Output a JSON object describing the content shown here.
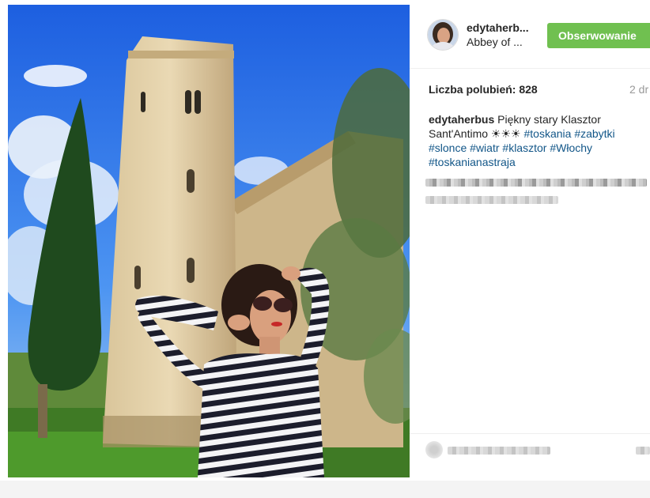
{
  "post": {
    "username": "edytaherb...",
    "location": "Abbey of ...",
    "follow_label": "Obserwowanie",
    "likes_text": "Liczba polubień: 828",
    "time_text": "2 dr",
    "caption": {
      "username": "edytaherbus",
      "text": "Piękny stary Klasztor Sant'Antimo ☀☀☀ ",
      "hashtags": [
        "#toskania",
        "#zabytki",
        "#slonce",
        "#wiatr",
        "#klasztor",
        "#Włochy",
        "#toskanianastraja"
      ]
    }
  },
  "colors": {
    "follow_button": "#70c050",
    "hashtag": "#125688",
    "text": "#262626",
    "muted": "#999999"
  },
  "icons": [
    "avatar",
    "heart-icon"
  ]
}
